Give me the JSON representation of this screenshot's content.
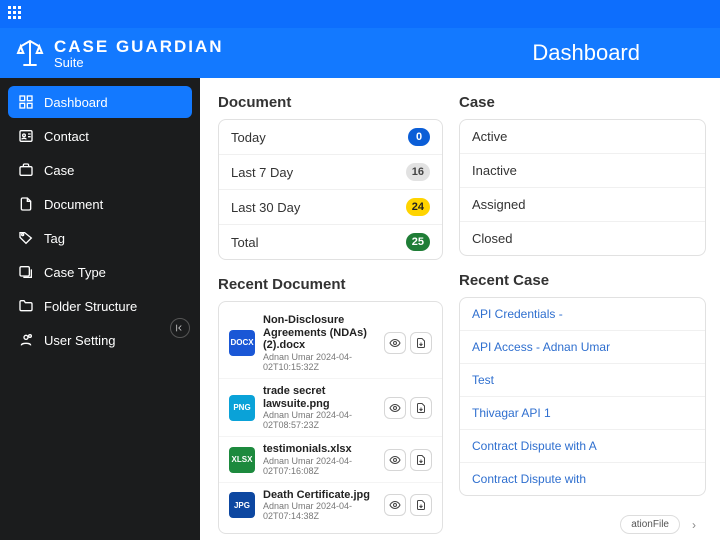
{
  "brand": {
    "line1": "CASE GUARDIAN",
    "line2": "Suite"
  },
  "page_title": "Dashboard",
  "sidebar": {
    "items": [
      {
        "label": "Dashboard",
        "icon": "dashboard-icon",
        "active": true
      },
      {
        "label": "Contact",
        "icon": "contact-icon"
      },
      {
        "label": "Case",
        "icon": "case-icon"
      },
      {
        "label": "Document",
        "icon": "document-icon"
      },
      {
        "label": "Tag",
        "icon": "tag-icon"
      },
      {
        "label": "Case Type",
        "icon": "case-type-icon"
      },
      {
        "label": "Folder Structure",
        "icon": "folder-icon"
      },
      {
        "label": "User Setting",
        "icon": "user-setting-icon"
      }
    ]
  },
  "doc_section_title": "Document",
  "case_section_title": "Case",
  "doc_stats": [
    {
      "label": "Today",
      "count": "0",
      "color": "blue"
    },
    {
      "label": "Last 7 Day",
      "count": "16",
      "color": "gray"
    },
    {
      "label": "Last 30 Day",
      "count": "24",
      "color": "yellow"
    },
    {
      "label": "Total",
      "count": "25",
      "color": "green"
    }
  ],
  "case_stats": [
    {
      "label": "Active"
    },
    {
      "label": "Inactive"
    },
    {
      "label": "Assigned"
    },
    {
      "label": "Closed"
    }
  ],
  "recent_doc_title": "Recent Document",
  "recent_case_title": "Recent Case",
  "recent_docs": [
    {
      "name": "Non-Disclosure Agreements (NDAs) (2).docx",
      "sub": "Adnan Umar 2024-04-02T10:15:32Z",
      "ext": "DOCX",
      "cls": "docx"
    },
    {
      "name": "trade secret lawsuite.png",
      "sub": "Adnan Umar 2024-04-02T08:57:23Z",
      "ext": "PNG",
      "cls": "png"
    },
    {
      "name": "testimonials.xlsx",
      "sub": "Adnan Umar 2024-04-02T07:16:08Z",
      "ext": "XLSX",
      "cls": "xlsx"
    },
    {
      "name": "Death Certificate.jpg",
      "sub": "Adnan Umar 2024-04-02T07:14:38Z",
      "ext": "JPG",
      "cls": "jpg"
    }
  ],
  "recent_cases": [
    "API Credentials -",
    "API Access - Adnan Umar",
    "Test",
    "Thivagar API 1",
    "Contract Dispute with A",
    "Contract Dispute with"
  ],
  "bubble_text": "ationFile"
}
